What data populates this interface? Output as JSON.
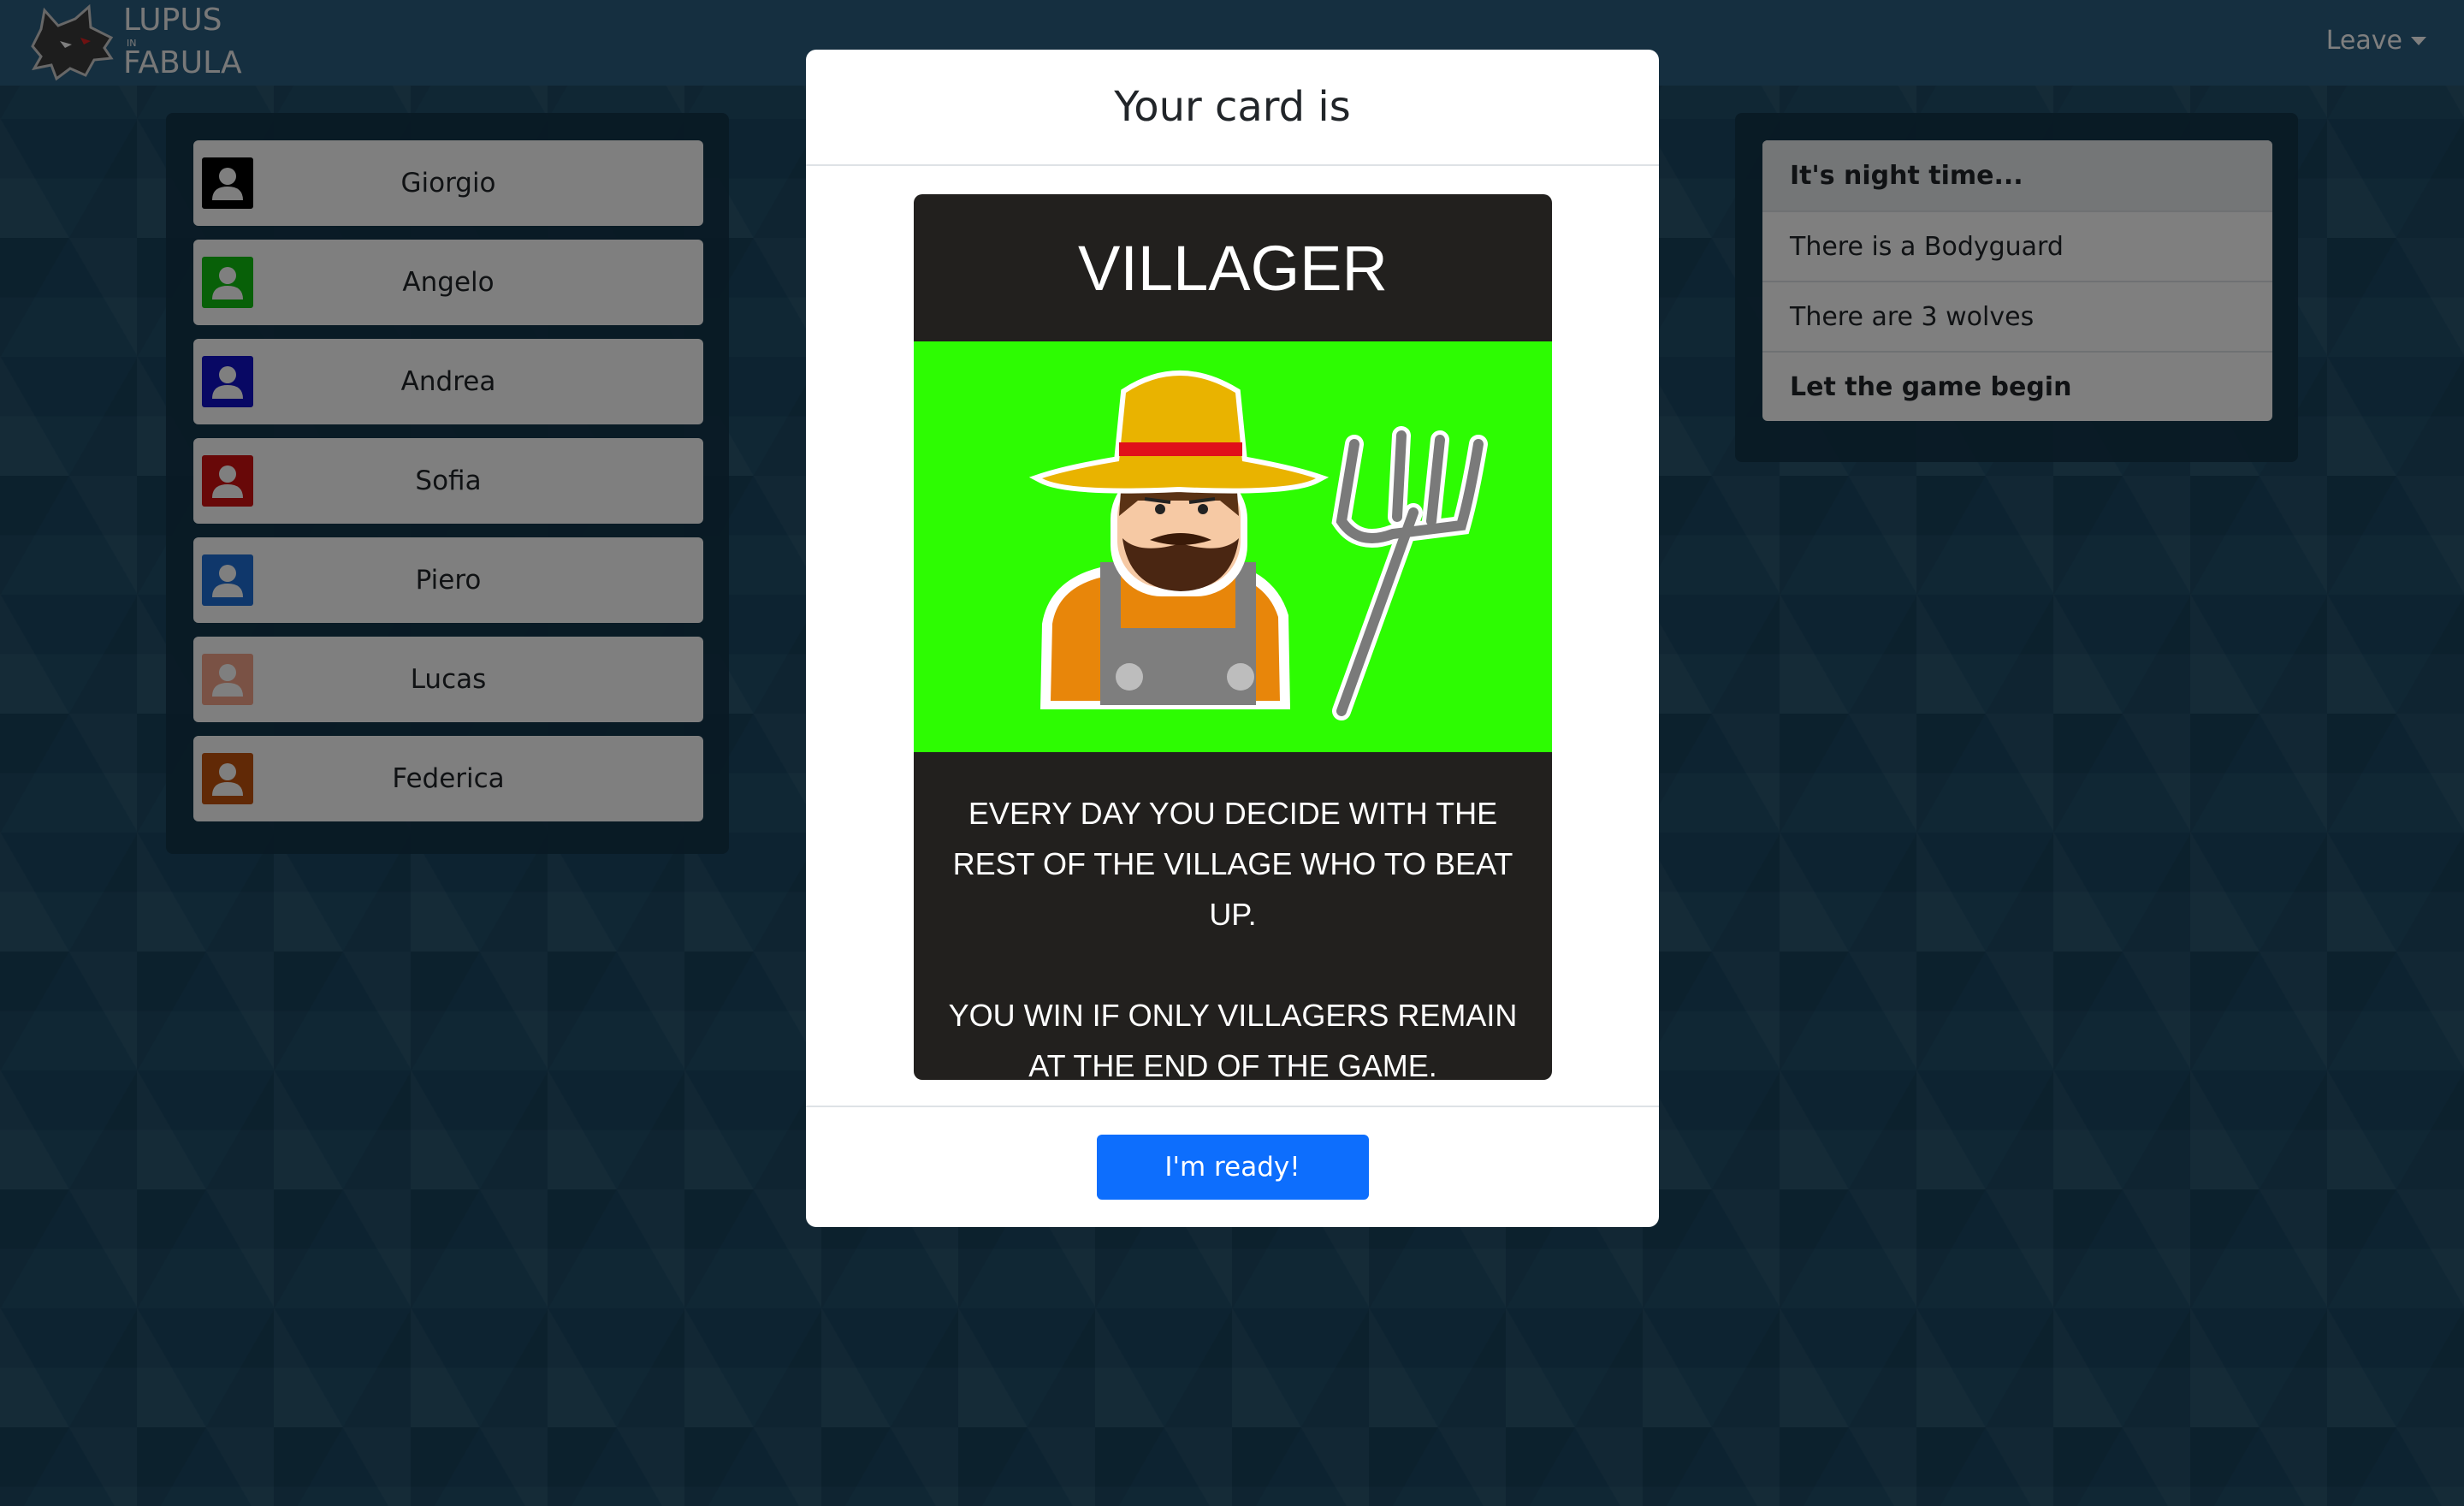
{
  "app": {
    "logo_top": "LUPUS",
    "logo_in": "IN",
    "logo_bottom": "FABULA",
    "leave_label": "Leave"
  },
  "players": [
    {
      "name": "Giorgio",
      "color": "#000000"
    },
    {
      "name": "Angelo",
      "color": "#10c010"
    },
    {
      "name": "Andrea",
      "color": "#1010c8"
    },
    {
      "name": "Sofia",
      "color": "#d01010"
    },
    {
      "name": "Piero",
      "color": "#1f6fd6"
    },
    {
      "name": "Lucas",
      "color": "#f4a48a"
    },
    {
      "name": "Federica",
      "color": "#c2530c"
    }
  ],
  "events": [
    {
      "text": "It's night time...",
      "bold": true
    },
    {
      "text": "There is a Bodyguard",
      "bold": false
    },
    {
      "text": "There are 3 wolves",
      "bold": false
    },
    {
      "text": "Let the game begin",
      "bold": true
    }
  ],
  "modal": {
    "title": "Your card is",
    "card_name": "VILLAGER",
    "card_desc_1": "EVERY DAY YOU DECIDE WITH THE REST OF THE VILLAGE WHO TO BEAT UP.",
    "card_desc_2": "YOU WIN IF ONLY VILLAGERS REMAIN AT THE END OF THE GAME.",
    "ready_label": "I'm ready!",
    "card_art_bg": "#2dfc02",
    "button_color": "#0d6efd"
  }
}
